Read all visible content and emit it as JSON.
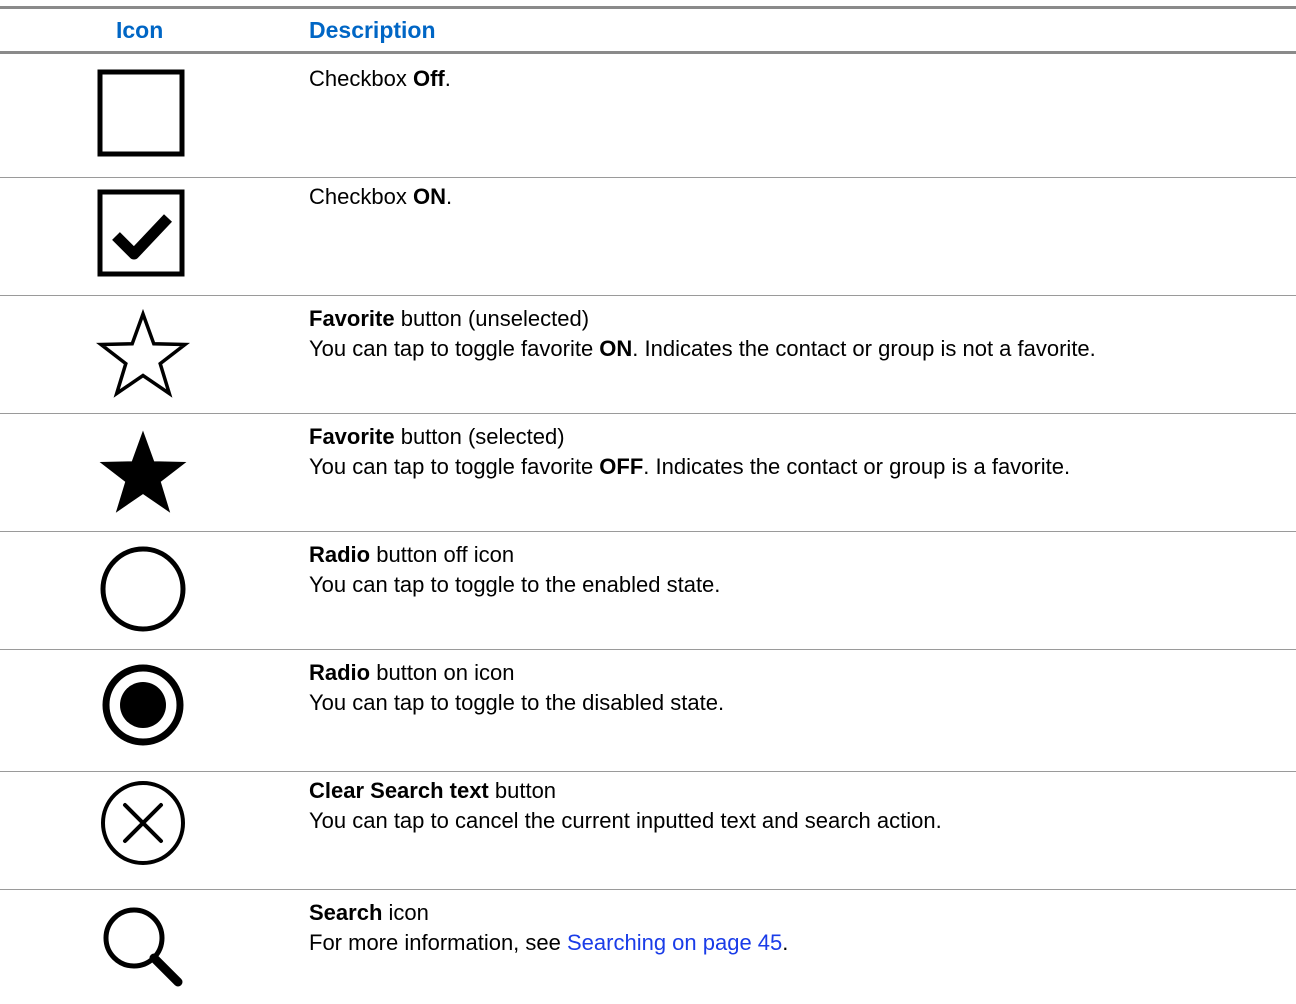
{
  "header": {
    "icon": "Icon",
    "description": "Description"
  },
  "rows": [
    {
      "icon": "checkbox-off-icon",
      "pre": "Checkbox ",
      "bold": "Off",
      "post": "."
    },
    {
      "icon": "checkbox-on-icon",
      "pre": "Checkbox ",
      "bold": "ON",
      "post": "."
    },
    {
      "icon": "star-outline-icon",
      "title_bold": "Favorite",
      "title_rest": " button (unselected)",
      "l2_pre": "You can tap to toggle favorite ",
      "l2_bold": "ON",
      "l2_post": ". Indicates the contact or group is not a favorite."
    },
    {
      "icon": "star-filled-icon",
      "title_bold": "Favorite",
      "title_rest": " button (selected)",
      "l2_pre": "You can tap to toggle favorite ",
      "l2_bold": "OFF",
      "l2_post": ". Indicates the contact or group is a favorite."
    },
    {
      "icon": "radio-off-icon",
      "title_bold": "Radio",
      "title_rest": " button off icon",
      "l2": "You can tap to toggle to the enabled state."
    },
    {
      "icon": "radio-on-icon",
      "title_bold": "Radio",
      "title_rest": " button on icon",
      "l2": "You can tap to toggle to the disabled state."
    },
    {
      "icon": "clear-search-icon",
      "title_bold": "Clear Search text",
      "title_rest": " button",
      "l2": "You can tap to cancel the current inputted text and search action."
    },
    {
      "icon": "search-icon",
      "title_bold": "Search",
      "title_rest": " icon",
      "l2_pre": "For more information, see ",
      "l2_link": "Searching on page 45",
      "l2_post": "."
    }
  ]
}
